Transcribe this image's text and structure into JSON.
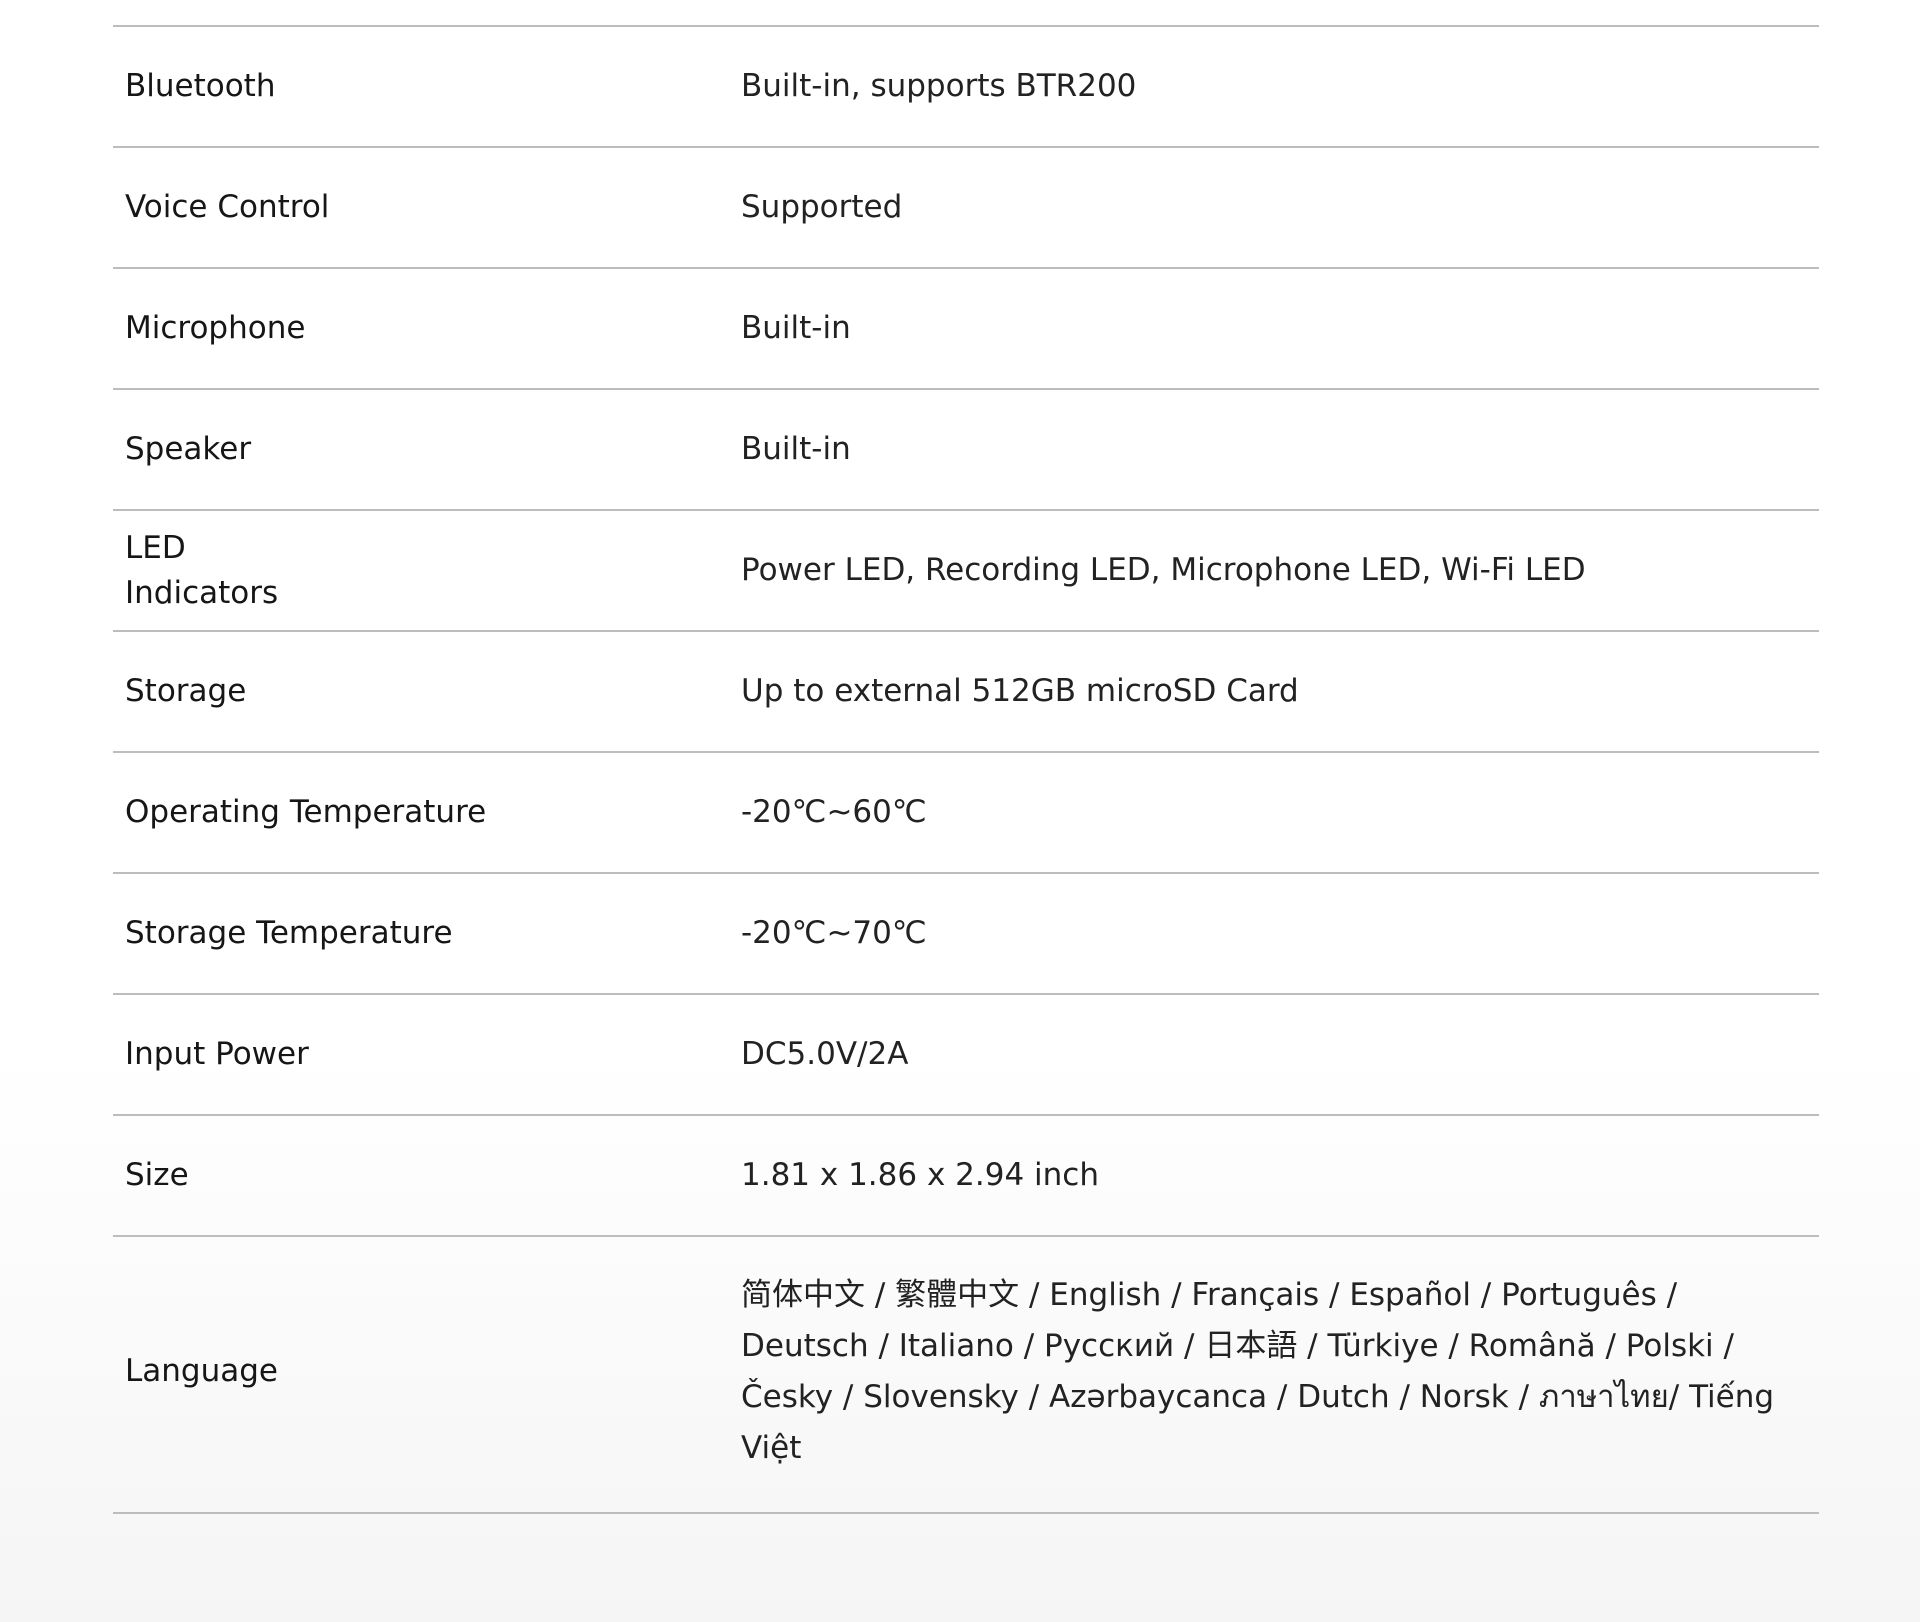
{
  "specs": [
    {
      "label": "Bluetooth",
      "value": "Built-in, supports BTR200"
    },
    {
      "label": "Voice Control",
      "value": "Supported"
    },
    {
      "label": "Microphone",
      "value": "Built-in"
    },
    {
      "label": "Speaker",
      "value": "Built-in"
    },
    {
      "label": "LED Indicators",
      "value": "Power LED, Recording LED, Microphone LED, Wi-Fi LED"
    },
    {
      "label": "Storage",
      "value": "Up to external 512GB microSD Card"
    },
    {
      "label": "Operating Temperature",
      "value": "-20℃~60℃"
    },
    {
      "label": "Storage Temperature",
      "value": "-20℃~70℃"
    },
    {
      "label": "Input Power",
      "value": "DC5.0V/2A"
    },
    {
      "label": "Size",
      "value": "1.81 x 1.86 x 2.94 inch"
    },
    {
      "label": "Language",
      "value": "简体中文 / 繁體中文 / English / Français / Español / Português / Deutsch / Italiano / Русский / 日本語 / Türkiye / Română / Polski / Česky / Slovensky / Azərbaycanca / Dutch / Norsk / ภาษาไทย/ Tiếng Việt"
    }
  ]
}
